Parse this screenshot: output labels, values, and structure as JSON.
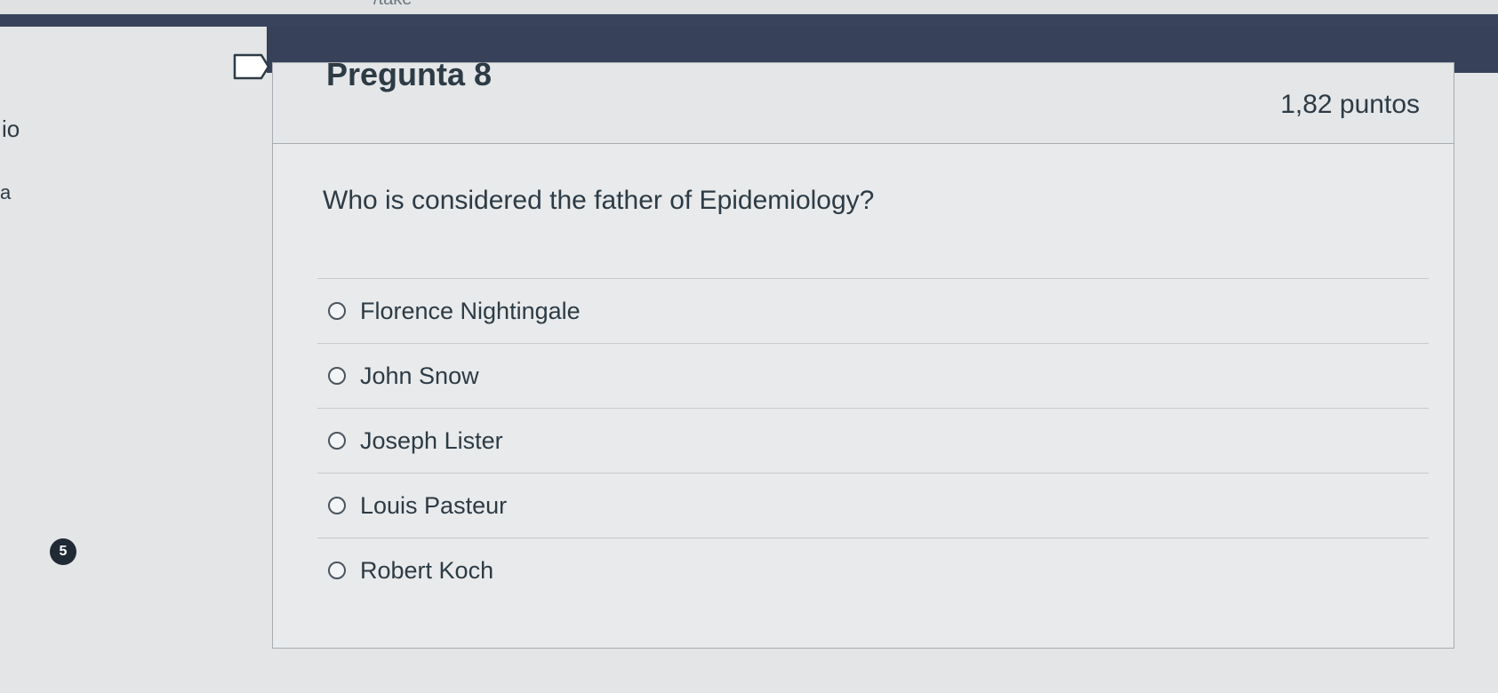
{
  "browser": {
    "url_fragment": "/take"
  },
  "sidebar": {
    "fragment_1": "io",
    "fragment_2": "a",
    "badge_count": "5"
  },
  "question": {
    "title": "Pregunta 8",
    "points": "1,82 puntos",
    "text": "Who is considered the father of Epidemiology?",
    "answers": [
      {
        "label": "Florence Nightingale",
        "selected": false
      },
      {
        "label": "John Snow",
        "selected": false
      },
      {
        "label": "Joseph Lister",
        "selected": false
      },
      {
        "label": "Louis Pasteur",
        "selected": false
      },
      {
        "label": "Robert Koch",
        "selected": false
      }
    ]
  },
  "icons": {
    "flag": "flag-outline-icon",
    "radio": "radio-unchecked-icon"
  },
  "colors": {
    "header_band": "#37425a",
    "text": "#2d3b45",
    "background": "#e3e5e6"
  }
}
